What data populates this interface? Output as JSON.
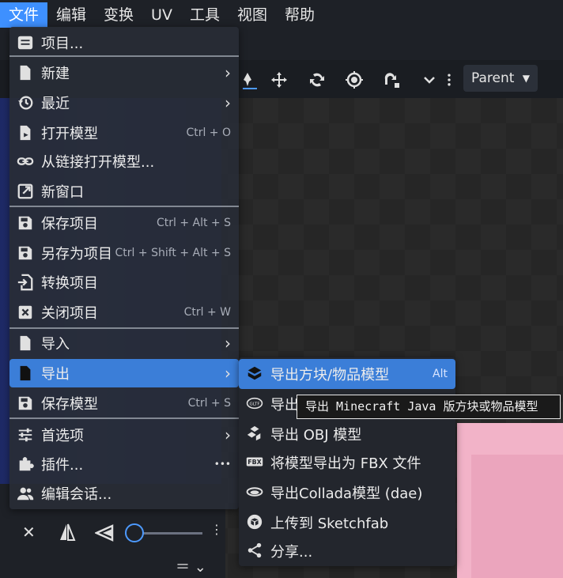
{
  "menubar": {
    "items": [
      "文件",
      "编辑",
      "变换",
      "UV",
      "工具",
      "视图",
      "帮助"
    ],
    "active_index": 0
  },
  "toolbar": {
    "parent_label": "Parent",
    "tools": [
      "paint-icon",
      "move-icon",
      "rotate-icon",
      "pivot-icon",
      "vertex-snap-icon",
      "chevron-down-icon",
      "more-vertical-icon"
    ]
  },
  "file_menu": {
    "items": [
      {
        "icon": "project-icon",
        "label": "项目...",
        "shortcut": "",
        "submenu": false
      },
      {
        "icon": "new-file-icon",
        "label": "新建",
        "shortcut": "",
        "submenu": true
      },
      {
        "icon": "history-icon",
        "label": "最近",
        "shortcut": "",
        "submenu": true
      },
      {
        "icon": "open-file-icon",
        "label": "打开模型",
        "shortcut": "Ctrl + O",
        "submenu": false
      },
      {
        "icon": "link-icon",
        "label": "从链接打开模型...",
        "shortcut": "",
        "submenu": false
      },
      {
        "icon": "new-window-icon",
        "label": "新窗口",
        "shortcut": "",
        "submenu": false
      },
      {
        "icon": "save-icon",
        "label": "保存项目",
        "shortcut": "Ctrl + Alt + S",
        "submenu": false
      },
      {
        "icon": "save-as-icon",
        "label": "另存为项目",
        "shortcut": "Ctrl + Shift + Alt + S",
        "submenu": false
      },
      {
        "icon": "convert-icon",
        "label": "转换项目",
        "shortcut": "",
        "submenu": false
      },
      {
        "icon": "close-icon",
        "label": "关闭项目",
        "shortcut": "Ctrl + W",
        "submenu": false
      },
      {
        "icon": "import-icon",
        "label": "导入",
        "shortcut": "",
        "submenu": true
      },
      {
        "icon": "export-icon",
        "label": "导出",
        "shortcut": "",
        "submenu": true
      },
      {
        "icon": "save-model-icon",
        "label": "保存模型",
        "shortcut": "Ctrl + S",
        "submenu": false
      },
      {
        "icon": "preferences-icon",
        "label": "首选项",
        "shortcut": "",
        "submenu": true
      },
      {
        "icon": "plugin-icon",
        "label": "插件...",
        "shortcut": "",
        "submenu": false
      },
      {
        "icon": "users-icon",
        "label": "编辑会话...",
        "shortcut": "",
        "submenu": false
      }
    ],
    "highlighted_index": 11,
    "more_glyph": "•••"
  },
  "export_submenu": {
    "items": [
      {
        "icon": "block-model-icon",
        "label": "导出方块/物品模型",
        "shortcut": "Alt"
      },
      {
        "icon": "gltf-icon",
        "label": "导出",
        "shortcut": ""
      },
      {
        "icon": "obj-icon",
        "label": "导出 OBJ 模型",
        "shortcut": ""
      },
      {
        "icon": "fbx-icon",
        "label": "将模型导出为 FBX 文件",
        "shortcut": ""
      },
      {
        "icon": "collada-icon",
        "label": "导出Collada模型 (dae)",
        "shortcut": ""
      },
      {
        "icon": "sketchfab-icon",
        "label": "上传到 Sketchfab",
        "shortcut": ""
      },
      {
        "icon": "share-icon",
        "label": "分享...",
        "shortcut": ""
      }
    ],
    "highlighted_index": 0,
    "fbx_badge": "FBX",
    "gltf_badge": "GLTF"
  },
  "tooltip": "导出 Minecraft Java 版方块或物品模型",
  "colors": {
    "accent": "#3b7ed8",
    "menubar_active": "#3e90ff",
    "menu_bg": "#282c36",
    "cube_pink": "#f2b3c8"
  }
}
